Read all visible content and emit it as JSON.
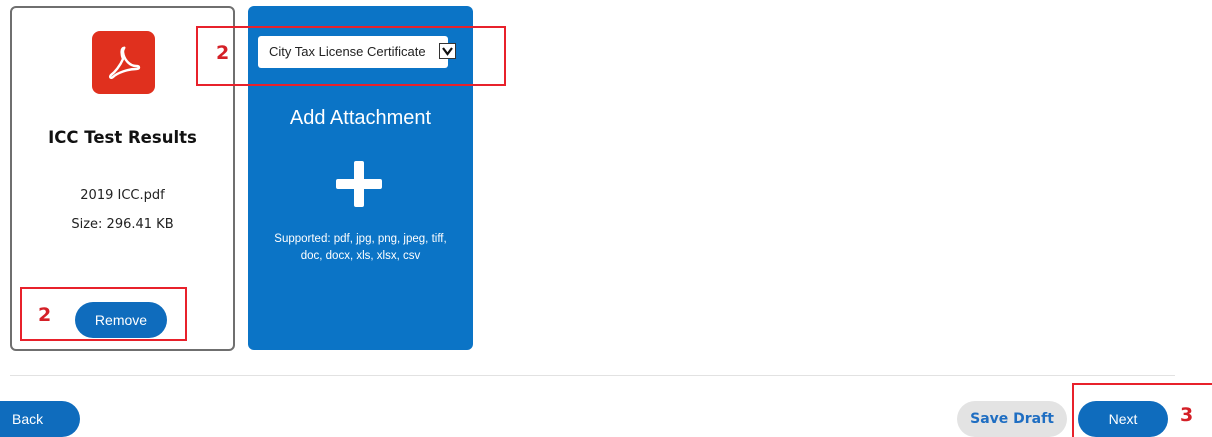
{
  "file_card": {
    "icon": "pdf-icon",
    "title": "ICC Test Results",
    "file_name": "2019 ICC.pdf",
    "file_size": "Size: 296.41 KB",
    "remove_label": "Remove"
  },
  "attachment_card": {
    "select_value": "City Tax License Certificate",
    "title": "Add Attachment",
    "icon": "plus-icon",
    "supported_text": "Supported: pdf, jpg, png, jpeg, tiff, doc, docx, xls, xlsx, csv"
  },
  "annotations": {
    "select_marker": "2",
    "remove_marker": "2",
    "next_marker": "3",
    "color": "#e8212b"
  },
  "footer": {
    "back_label": "Back",
    "save_draft_label": "Save Draft",
    "next_label": "Next"
  },
  "colors": {
    "primary_blue": "#0f6cbd",
    "card_blue": "#0b74c6",
    "pdf_red": "#e0301e"
  }
}
